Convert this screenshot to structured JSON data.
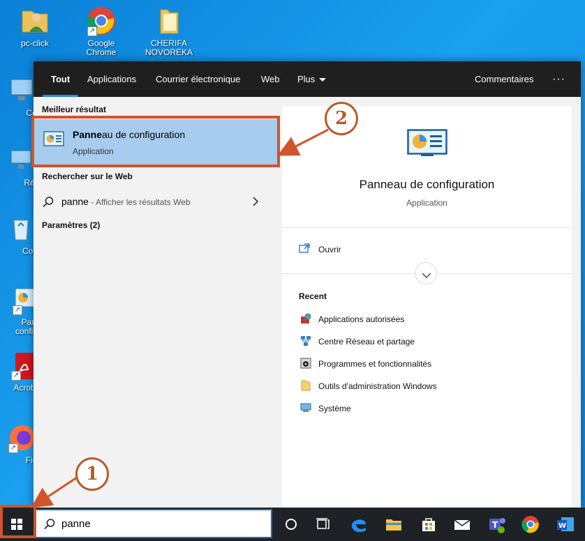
{
  "desktop": {
    "icons": [
      {
        "label": "pc-click",
        "icon": "user-folder-icon"
      },
      {
        "label": "Google Chrome",
        "icon": "chrome-icon"
      },
      {
        "label": "CHERIFA NOVOREKA",
        "icon": "folder-icon"
      },
      {
        "label": "Ce",
        "icon": "computer-icon"
      },
      {
        "label": "Rés",
        "icon": "network-icon"
      },
      {
        "label": "Corb",
        "icon": "recycle-bin-icon"
      },
      {
        "label": "Panne config",
        "icon": "control-panel-icon"
      },
      {
        "label": "Acrobat D",
        "icon": "acrobat-icon"
      },
      {
        "label": "Fire",
        "icon": "firefox-icon"
      }
    ]
  },
  "search_panel": {
    "tabs": [
      {
        "label": "Tout",
        "active": true
      },
      {
        "label": "Applications"
      },
      {
        "label": "Courrier électronique"
      },
      {
        "label": "Web"
      },
      {
        "label": "Plus"
      }
    ],
    "feedback_label": "Commentaires",
    "more_options": "···",
    "best_match_header": "Meilleur résultat",
    "best_match": {
      "title_highlight": "Panne",
      "title_rest": "au de configuration",
      "subtitle": "Application"
    },
    "web_header": "Rechercher sur le Web",
    "web_result": {
      "query": "panne",
      "hint": " - Afficher les résultats Web"
    },
    "settings_header": "Paramètres (2)",
    "preview": {
      "title": "Panneau de configuration",
      "subtitle": "Application",
      "action_open": "Ouvrir",
      "recent_header": "Recent",
      "recent_items": [
        {
          "label": "Applications autorisées",
          "icon": "firewall-icon"
        },
        {
          "label": "Centre Réseau et partage",
          "icon": "network-center-icon"
        },
        {
          "label": "Programmes et fonctionnalités",
          "icon": "programs-icon"
        },
        {
          "label": "Outils d'administration Windows",
          "icon": "folder-icon"
        },
        {
          "label": "Système",
          "icon": "system-icon"
        }
      ]
    }
  },
  "taskbar": {
    "search_value": "panne"
  },
  "annotations": {
    "step1": "1",
    "step2": "2",
    "accent_color": "#d0542a"
  }
}
